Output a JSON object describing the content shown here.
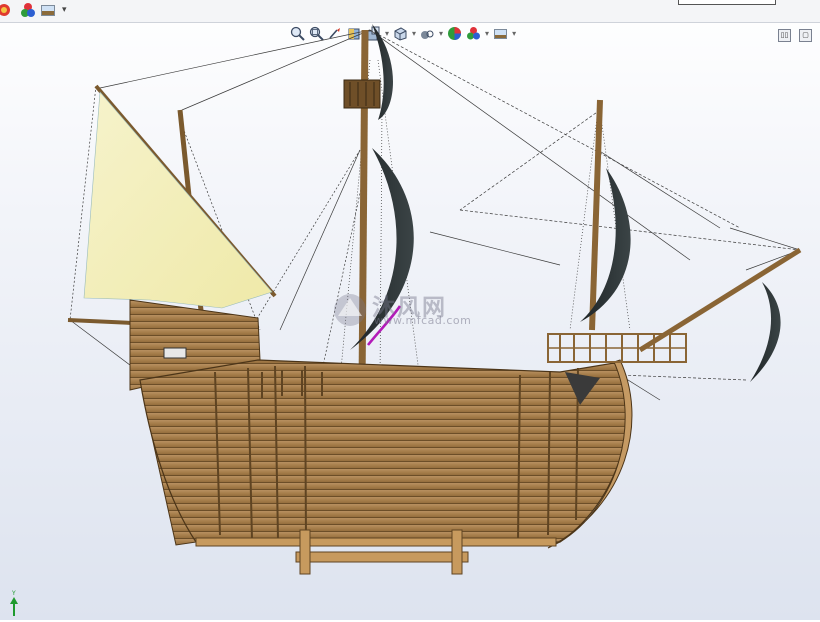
{
  "toolbar": {
    "left_icons": [
      "palette-icon",
      "appearance-icon",
      "scene-icon"
    ],
    "dropdown": "chevron-down-icon"
  },
  "heads_up_toolbar": {
    "icons": [
      "zoom-to-fit-icon",
      "zoom-area-icon",
      "previous-view-icon",
      "section-view-icon",
      "dynamic-annotation-icon",
      "view-orientation-icon",
      "display-style-icon",
      "hide-show-icon",
      "edit-appearance-icon",
      "apply-scene-icon",
      "view-settings-icon"
    ]
  },
  "viewport_controls": {
    "icons": [
      "split-view-icon",
      "restore-view-icon"
    ]
  },
  "watermark": {
    "text": "沐风网",
    "url": "www.mfcad.com"
  },
  "triad": {
    "y_label": "Y"
  },
  "colors": {
    "wood": "#a9834f",
    "wood_dark": "#5f4422",
    "sail_dark": "#2c3134",
    "sail_light": "#f4f1c2",
    "selection": "#b31ab8"
  }
}
